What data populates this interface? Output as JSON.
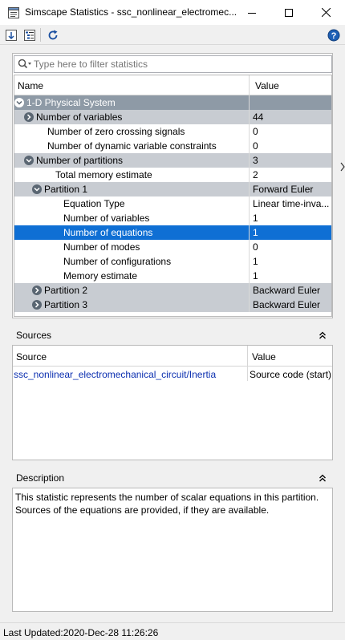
{
  "window": {
    "title": "Simscape Statistics - ssc_nonlinear_electromec..."
  },
  "toolbar": {
    "buttons": [
      "sort-icon",
      "hierarchy-icon",
      "refresh-icon"
    ],
    "help": "help-icon"
  },
  "filter": {
    "placeholder": "Type here to filter statistics",
    "value": ""
  },
  "stats": {
    "columns": [
      "Name",
      "Value"
    ],
    "rows": [
      {
        "name": "1-D Physical System",
        "value": "",
        "level": 0,
        "toggle": "expanded",
        "style": "root"
      },
      {
        "name": "Number of variables",
        "value": "44",
        "level": 1,
        "toggle": "collapsed",
        "style": "group"
      },
      {
        "name": "Number of zero crossing signals",
        "value": "0",
        "level": 1,
        "toggle": "none",
        "style": "plain"
      },
      {
        "name": "Number of dynamic variable constraints",
        "value": "0",
        "level": 1,
        "toggle": "none",
        "style": "plain"
      },
      {
        "name": "Number of partitions",
        "value": "3",
        "level": 1,
        "toggle": "expanded",
        "style": "group"
      },
      {
        "name": "Total memory estimate",
        "value": "2",
        "level": 2,
        "toggle": "none",
        "style": "plain"
      },
      {
        "name": "Partition 1",
        "value": "Forward Euler",
        "level": 2,
        "toggle": "expanded",
        "style": "group"
      },
      {
        "name": "Equation Type",
        "value": "Linear time-inva...",
        "level": 3,
        "toggle": "none",
        "style": "plain"
      },
      {
        "name": "Number of variables",
        "value": "1",
        "level": 3,
        "toggle": "none",
        "style": "plain"
      },
      {
        "name": "Number of equations",
        "value": "1",
        "level": 3,
        "toggle": "none",
        "style": "selected"
      },
      {
        "name": "Number of modes",
        "value": "0",
        "level": 3,
        "toggle": "none",
        "style": "plain"
      },
      {
        "name": "Number of configurations",
        "value": "1",
        "level": 3,
        "toggle": "none",
        "style": "plain"
      },
      {
        "name": "Memory estimate",
        "value": "1",
        "level": 3,
        "toggle": "none",
        "style": "plain"
      },
      {
        "name": "Partition 2",
        "value": "Backward Euler",
        "level": 2,
        "toggle": "collapsed",
        "style": "group"
      },
      {
        "name": "Partition 3",
        "value": "Backward Euler",
        "level": 2,
        "toggle": "collapsed",
        "style": "group"
      }
    ]
  },
  "sources": {
    "title": "Sources",
    "columns": [
      "Source",
      "Value"
    ],
    "rows": [
      {
        "source": "ssc_nonlinear_electromechanical_circuit/Inertia",
        "value": "Source code (start)"
      }
    ]
  },
  "description": {
    "title": "Description",
    "text": "This statistic represents the number of scalar equations in this partition. Sources of the equations are provided, if they are available."
  },
  "status": {
    "text": "Last Updated:2020-Dec-28 11:26:26"
  },
  "colors": {
    "root_row": "#8e9aa6",
    "group_row": "#c8ccd2",
    "selected_row": "#0f6fd4",
    "link": "#0b2fb0"
  }
}
